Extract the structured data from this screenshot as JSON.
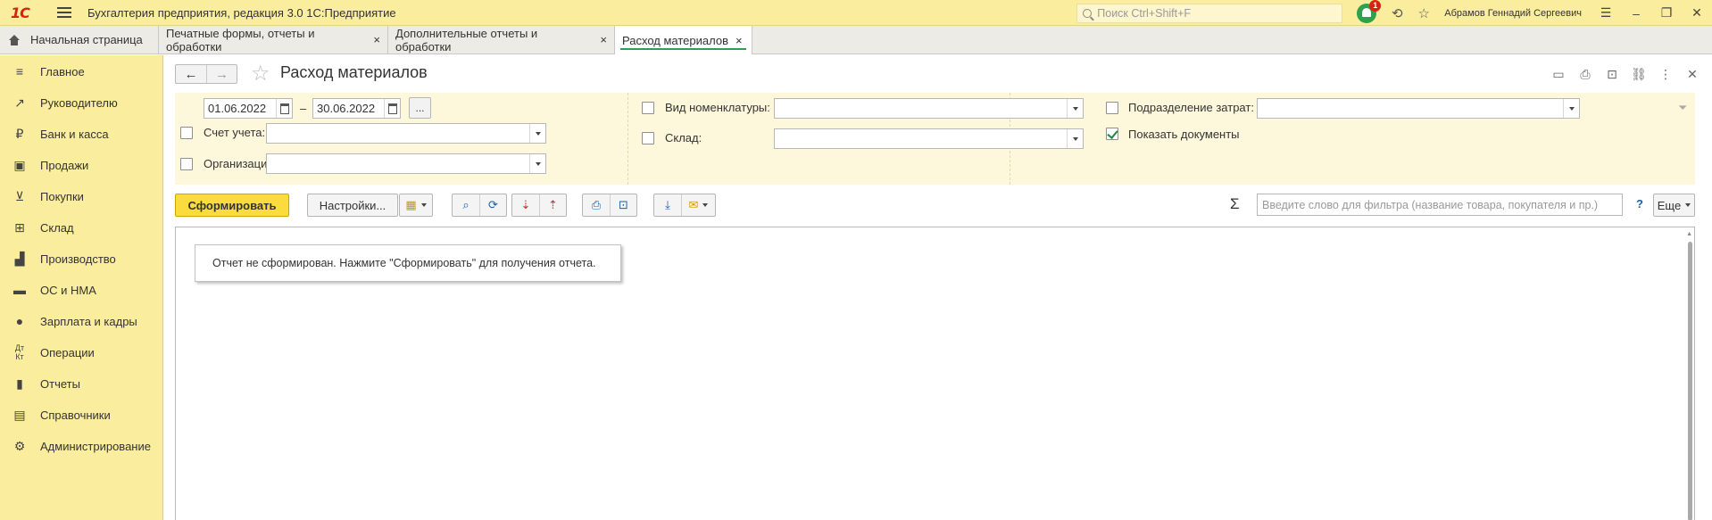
{
  "titlebar": {
    "logo": "1С",
    "app_title": "Бухгалтерия предприятия, редакция 3.0 1С:Предприятие",
    "search_placeholder": "Поиск Ctrl+Shift+F",
    "notification_count": "1",
    "user_name": "Абрамов Геннадий Сергеевич"
  },
  "tabs": [
    {
      "label": "Начальная страница",
      "closable": false,
      "active": false
    },
    {
      "label": "Печатные формы, отчеты и обработки",
      "closable": true,
      "active": false
    },
    {
      "label": "Дополнительные отчеты и обработки",
      "closable": true,
      "active": false
    },
    {
      "label": "Расход материалов",
      "closable": true,
      "active": true
    }
  ],
  "tab_close_glyph": "×",
  "sidebar": {
    "items": [
      {
        "label": "Главное",
        "icon": "menu-list-icon"
      },
      {
        "label": "Руководителю",
        "icon": "trend-icon"
      },
      {
        "label": "Банк и касса",
        "icon": "ruble-coin-icon"
      },
      {
        "label": "Продажи",
        "icon": "shopping-bag-icon"
      },
      {
        "label": "Покупки",
        "icon": "cart-icon"
      },
      {
        "label": "Склад",
        "icon": "warehouse-grid-icon"
      },
      {
        "label": "Производство",
        "icon": "factory-icon"
      },
      {
        "label": "ОС и НМА",
        "icon": "truck-icon"
      },
      {
        "label": "Зарплата и кадры",
        "icon": "person-icon"
      },
      {
        "label": "Операции",
        "icon": "debit-credit-icon"
      },
      {
        "label": "Отчеты",
        "icon": "bar-chart-icon"
      },
      {
        "label": "Справочники",
        "icon": "books-icon"
      },
      {
        "label": "Администрирование",
        "icon": "gear-icon"
      }
    ]
  },
  "form": {
    "title": "Расход материалов",
    "period": {
      "from": "01.06.2022",
      "dash": "–",
      "to": "30.06.2022",
      "more_label": "..."
    },
    "account_label": "Счет учета:",
    "organization_label": "Организация:",
    "nomenclature_type_label": "Вид номенклатуры:",
    "warehouse_label": "Склад:",
    "cost_division_label": "Подразделение затрат:",
    "show_documents_label": "Показать документы",
    "show_documents_checked": true
  },
  "toolbar": {
    "generate_label": "Сформировать",
    "settings_label": "Настройки...",
    "sigma": "Σ",
    "filter_placeholder": "Введите слово для фильтра (название товара, покупателя и пр.)",
    "help_label": "?",
    "more_label": "Еще"
  },
  "report": {
    "message": "Отчет не сформирован. Нажмите \"Сформировать\" для получения отчета."
  },
  "colors": {
    "accent_yellow": "#fcdc3c",
    "panel_yellow": "#fbed9e",
    "active_tab_underline": "#2fa04d"
  }
}
